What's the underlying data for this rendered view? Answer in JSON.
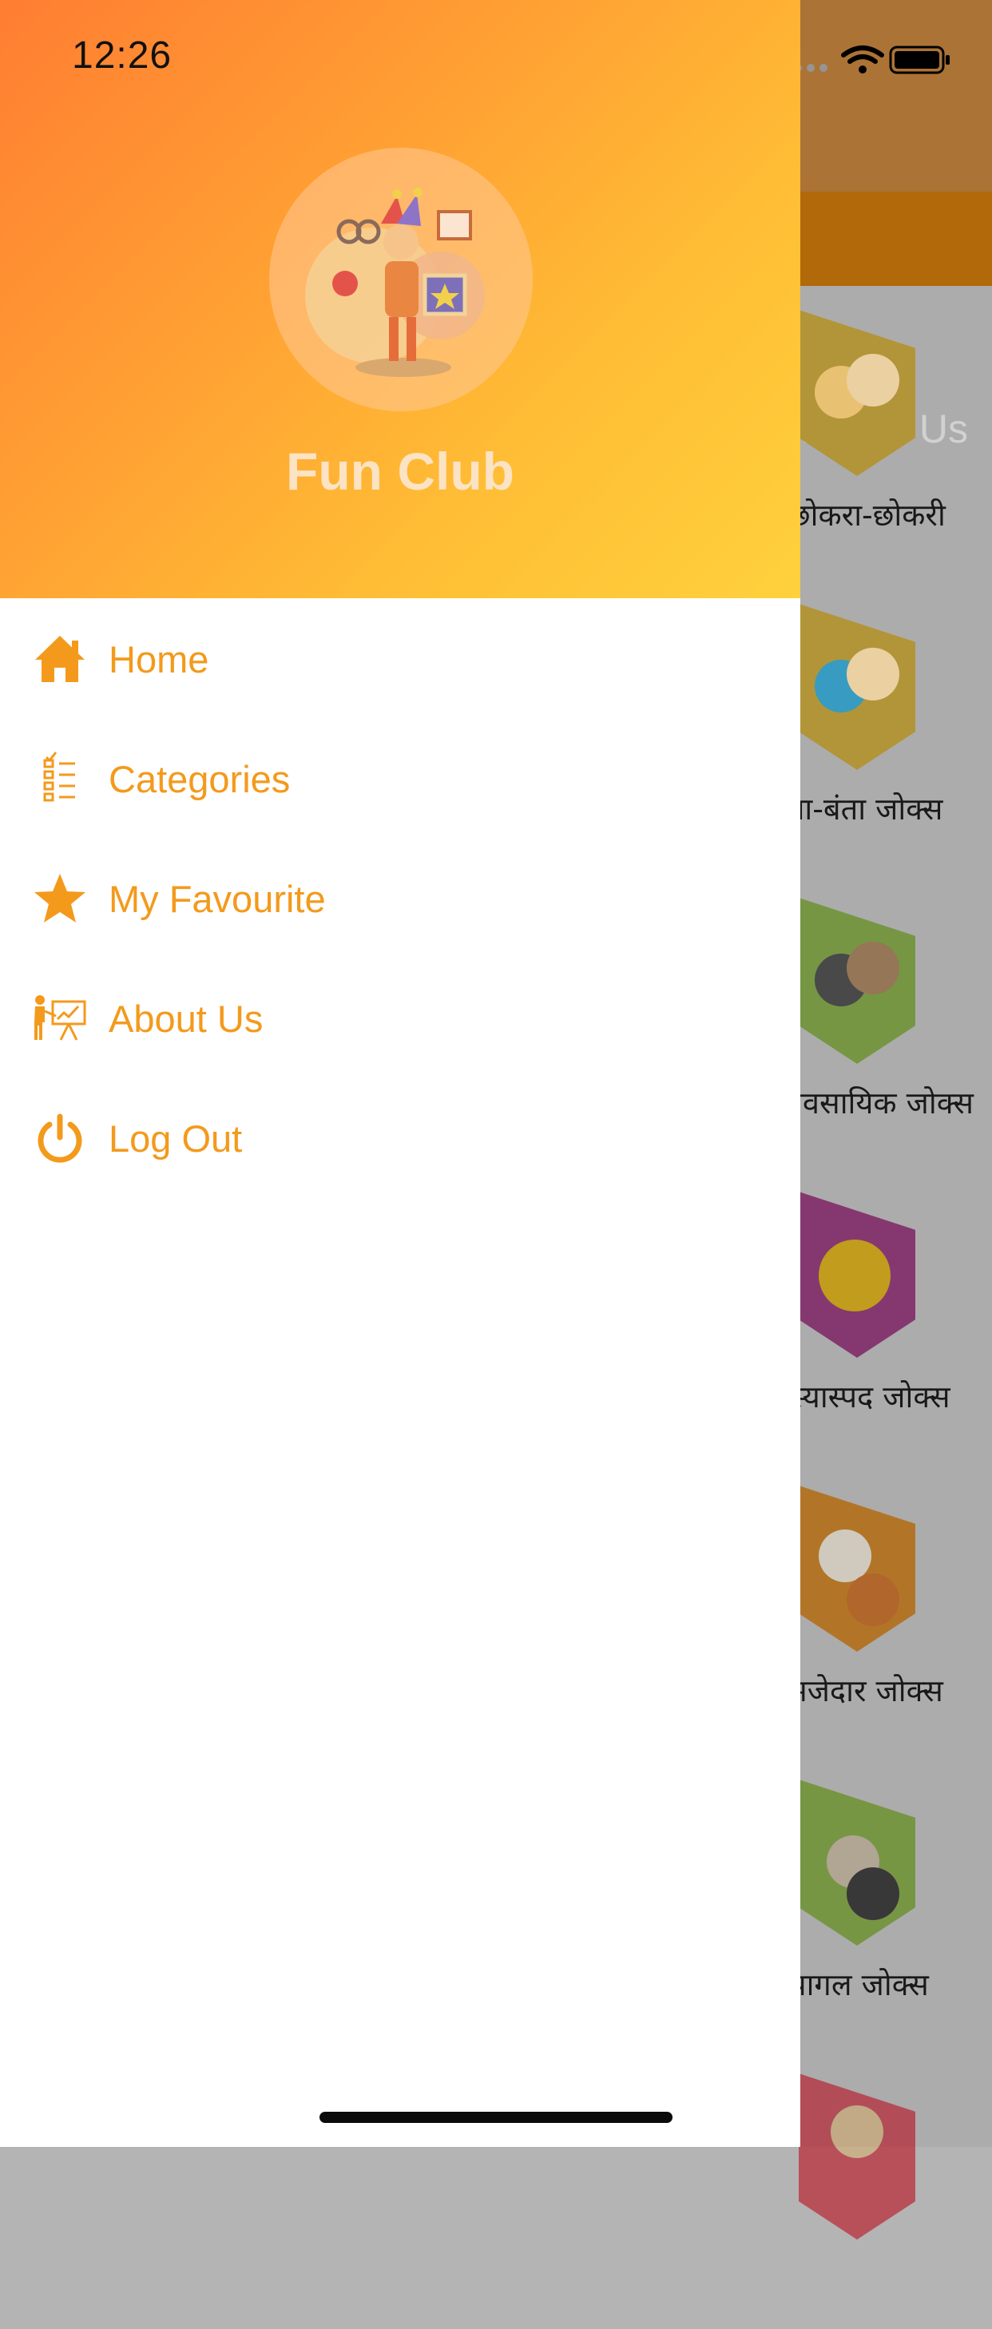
{
  "status_bar": {
    "time": "12:26"
  },
  "header": {
    "app_name": "Fun Club"
  },
  "menu": [
    {
      "label": "Home",
      "icon": "home-icon"
    },
    {
      "label": "Categories",
      "icon": "checklist-icon"
    },
    {
      "label": "My Favourite",
      "icon": "star-icon"
    },
    {
      "label": "About Us",
      "icon": "presentation-icon"
    },
    {
      "label": "Log Out",
      "icon": "power-icon"
    }
  ],
  "background": {
    "tab_label": "About Us",
    "items": [
      {
        "label": "छोकरा-छोकरी"
      },
      {
        "label": "संता-बंता जोक्स"
      },
      {
        "label": "व्यावसायिक जोक्स"
      },
      {
        "label": "हास्यास्पद जोक्स"
      },
      {
        "label": "मजेदार जोक्स"
      },
      {
        "label": "पागल जोक्स"
      }
    ]
  },
  "colors": {
    "accent": "#F39A1C",
    "header_start": "#FF7D32",
    "header_end": "#FFD13D"
  }
}
